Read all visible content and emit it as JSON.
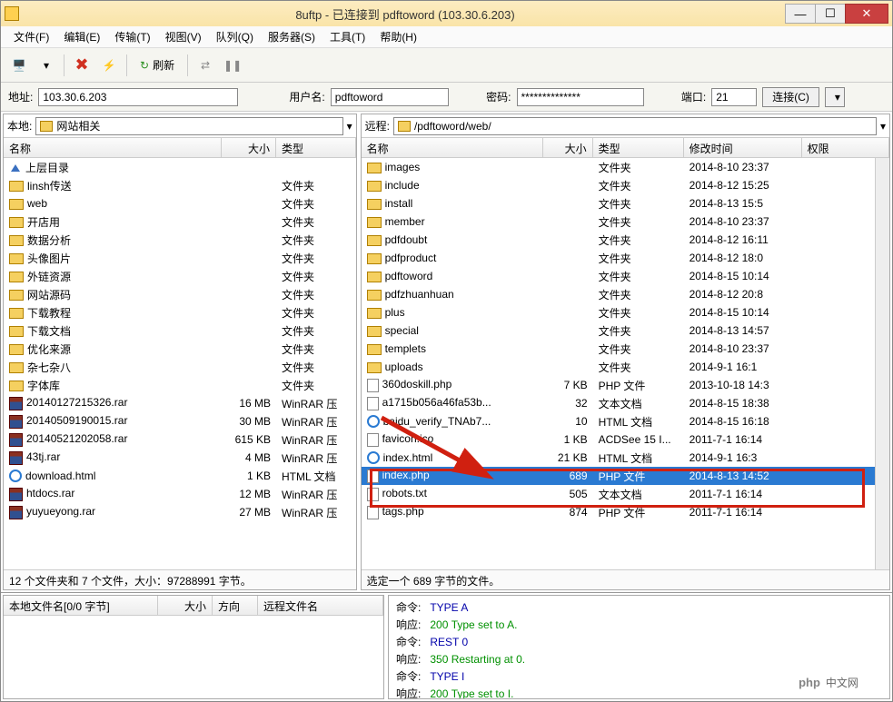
{
  "window": {
    "title": "8uftp - 已连接到 pdftoword (103.30.6.203)"
  },
  "menu": {
    "file": "文件(F)",
    "edit": "编辑(E)",
    "transfer": "传输(T)",
    "view": "视图(V)",
    "queue": "队列(Q)",
    "server": "服务器(S)",
    "tools": "工具(T)",
    "help": "帮助(H)"
  },
  "toolbar": {
    "refresh": "刷新"
  },
  "connbar": {
    "addr_label": "地址:",
    "addr": "103.30.6.203",
    "user_label": "用户名:",
    "user": "pdftoword",
    "pass_label": "密码:",
    "pass": "**************",
    "port_label": "端口:",
    "port": "21",
    "connect_btn": "连接(C)"
  },
  "local": {
    "label": "本地:",
    "path": "网站相关",
    "cols": {
      "name": "名称",
      "size": "大小",
      "type": "类型"
    },
    "items": [
      {
        "icon": "up",
        "name": "上层目录",
        "size": "",
        "type": ""
      },
      {
        "icon": "folder",
        "name": "linsh传送",
        "size": "",
        "type": "文件夹"
      },
      {
        "icon": "folder",
        "name": "web",
        "size": "",
        "type": "文件夹"
      },
      {
        "icon": "folder",
        "name": "开店用",
        "size": "",
        "type": "文件夹"
      },
      {
        "icon": "folder",
        "name": "数据分析",
        "size": "",
        "type": "文件夹"
      },
      {
        "icon": "folder",
        "name": "头像图片",
        "size": "",
        "type": "文件夹"
      },
      {
        "icon": "folder",
        "name": "外链资源",
        "size": "",
        "type": "文件夹"
      },
      {
        "icon": "folder",
        "name": "网站源码",
        "size": "",
        "type": "文件夹"
      },
      {
        "icon": "folder",
        "name": "下载教程",
        "size": "",
        "type": "文件夹"
      },
      {
        "icon": "folder",
        "name": "下载文档",
        "size": "",
        "type": "文件夹"
      },
      {
        "icon": "folder",
        "name": "优化来源",
        "size": "",
        "type": "文件夹"
      },
      {
        "icon": "folder",
        "name": "杂七杂八",
        "size": "",
        "type": "文件夹"
      },
      {
        "icon": "folder",
        "name": "字体库",
        "size": "",
        "type": "文件夹"
      },
      {
        "icon": "rar",
        "name": "20140127215326.rar",
        "size": "16 MB",
        "type": "WinRAR 压"
      },
      {
        "icon": "rar",
        "name": "20140509190015.rar",
        "size": "30 MB",
        "type": "WinRAR 压"
      },
      {
        "icon": "rar",
        "name": "20140521202058.rar",
        "size": "615 KB",
        "type": "WinRAR 压"
      },
      {
        "icon": "rar",
        "name": "43tj.rar",
        "size": "4 MB",
        "type": "WinRAR 压"
      },
      {
        "icon": "ie",
        "name": "download.html",
        "size": "1 KB",
        "type": "HTML 文档"
      },
      {
        "icon": "rar",
        "name": "htdocs.rar",
        "size": "12 MB",
        "type": "WinRAR 压"
      },
      {
        "icon": "rar",
        "name": "yuyueyong.rar",
        "size": "27 MB",
        "type": "WinRAR 压"
      }
    ],
    "status": "12 个文件夹和 7 个文件，大小：97288991 字节。"
  },
  "remote": {
    "label": "远程:",
    "path": "/pdftoword/web/",
    "cols": {
      "name": "名称",
      "size": "大小",
      "type": "类型",
      "date": "修改时间",
      "perm": "权限"
    },
    "items": [
      {
        "icon": "folder",
        "name": "images",
        "size": "",
        "type": "文件夹",
        "date": "2014-8-10 23:37"
      },
      {
        "icon": "folder",
        "name": "include",
        "size": "",
        "type": "文件夹",
        "date": "2014-8-12 15:25"
      },
      {
        "icon": "folder",
        "name": "install",
        "size": "",
        "type": "文件夹",
        "date": "2014-8-13 15:5"
      },
      {
        "icon": "folder",
        "name": "member",
        "size": "",
        "type": "文件夹",
        "date": "2014-8-10 23:37"
      },
      {
        "icon": "folder",
        "name": "pdfdoubt",
        "size": "",
        "type": "文件夹",
        "date": "2014-8-12 16:11"
      },
      {
        "icon": "folder",
        "name": "pdfproduct",
        "size": "",
        "type": "文件夹",
        "date": "2014-8-12 18:0"
      },
      {
        "icon": "folder",
        "name": "pdftoword",
        "size": "",
        "type": "文件夹",
        "date": "2014-8-15 10:14"
      },
      {
        "icon": "folder",
        "name": "pdfzhuanhuan",
        "size": "",
        "type": "文件夹",
        "date": "2014-8-12 20:8"
      },
      {
        "icon": "folder",
        "name": "plus",
        "size": "",
        "type": "文件夹",
        "date": "2014-8-15 10:14"
      },
      {
        "icon": "folder",
        "name": "special",
        "size": "",
        "type": "文件夹",
        "date": "2014-8-13 14:57"
      },
      {
        "icon": "folder",
        "name": "templets",
        "size": "",
        "type": "文件夹",
        "date": "2014-8-10 23:37"
      },
      {
        "icon": "folder",
        "name": "uploads",
        "size": "",
        "type": "文件夹",
        "date": "2014-9-1 16:1"
      },
      {
        "icon": "file",
        "name": "360doskill.php",
        "size": "7 KB",
        "type": "PHP 文件",
        "date": "2013-10-18 14:3"
      },
      {
        "icon": "file",
        "name": "a1715b056a46fa53b...",
        "size": "32",
        "type": "文本文档",
        "date": "2014-8-15 18:38"
      },
      {
        "icon": "ie",
        "name": "baidu_verify_TNAb7...",
        "size": "10",
        "type": "HTML 文档",
        "date": "2014-8-15 16:18"
      },
      {
        "icon": "file",
        "name": "favicon.ico",
        "size": "1 KB",
        "type": "ACDSee 15 I...",
        "date": "2011-7-1 16:14"
      },
      {
        "icon": "ie",
        "name": "index.html",
        "size": "21 KB",
        "type": "HTML 文档",
        "date": "2014-9-1 16:3"
      },
      {
        "icon": "file",
        "name": "index.php",
        "size": "689",
        "type": "PHP 文件",
        "date": "2014-8-13 14:52",
        "selected": true
      },
      {
        "icon": "file",
        "name": "robots.txt",
        "size": "505",
        "type": "文本文档",
        "date": "2011-7-1 16:14"
      },
      {
        "icon": "file",
        "name": "tags.php",
        "size": "874",
        "type": "PHP 文件",
        "date": "2011-7-1 16:14"
      }
    ],
    "status": "选定一个 689 字节的文件。"
  },
  "queue": {
    "cols": {
      "localname": "本地文件名[0/0 字节]",
      "size": "大小",
      "dir": "方向",
      "remotename": "远程文件名"
    }
  },
  "log": [
    {
      "t": "cmd",
      "label": "命令:",
      "text": "TYPE A"
    },
    {
      "t": "resp",
      "label": "响应:",
      "text": "200 Type set to A."
    },
    {
      "t": "cmd",
      "label": "命令:",
      "text": "REST 0"
    },
    {
      "t": "resp",
      "label": "响应:",
      "text": "350 Restarting at 0."
    },
    {
      "t": "cmd",
      "label": "命令:",
      "text": "TYPE I"
    },
    {
      "t": "resp",
      "label": "响应:",
      "text": "200 Type set to I."
    }
  ],
  "watermark": {
    "php": "php",
    "cn": "中文网"
  }
}
